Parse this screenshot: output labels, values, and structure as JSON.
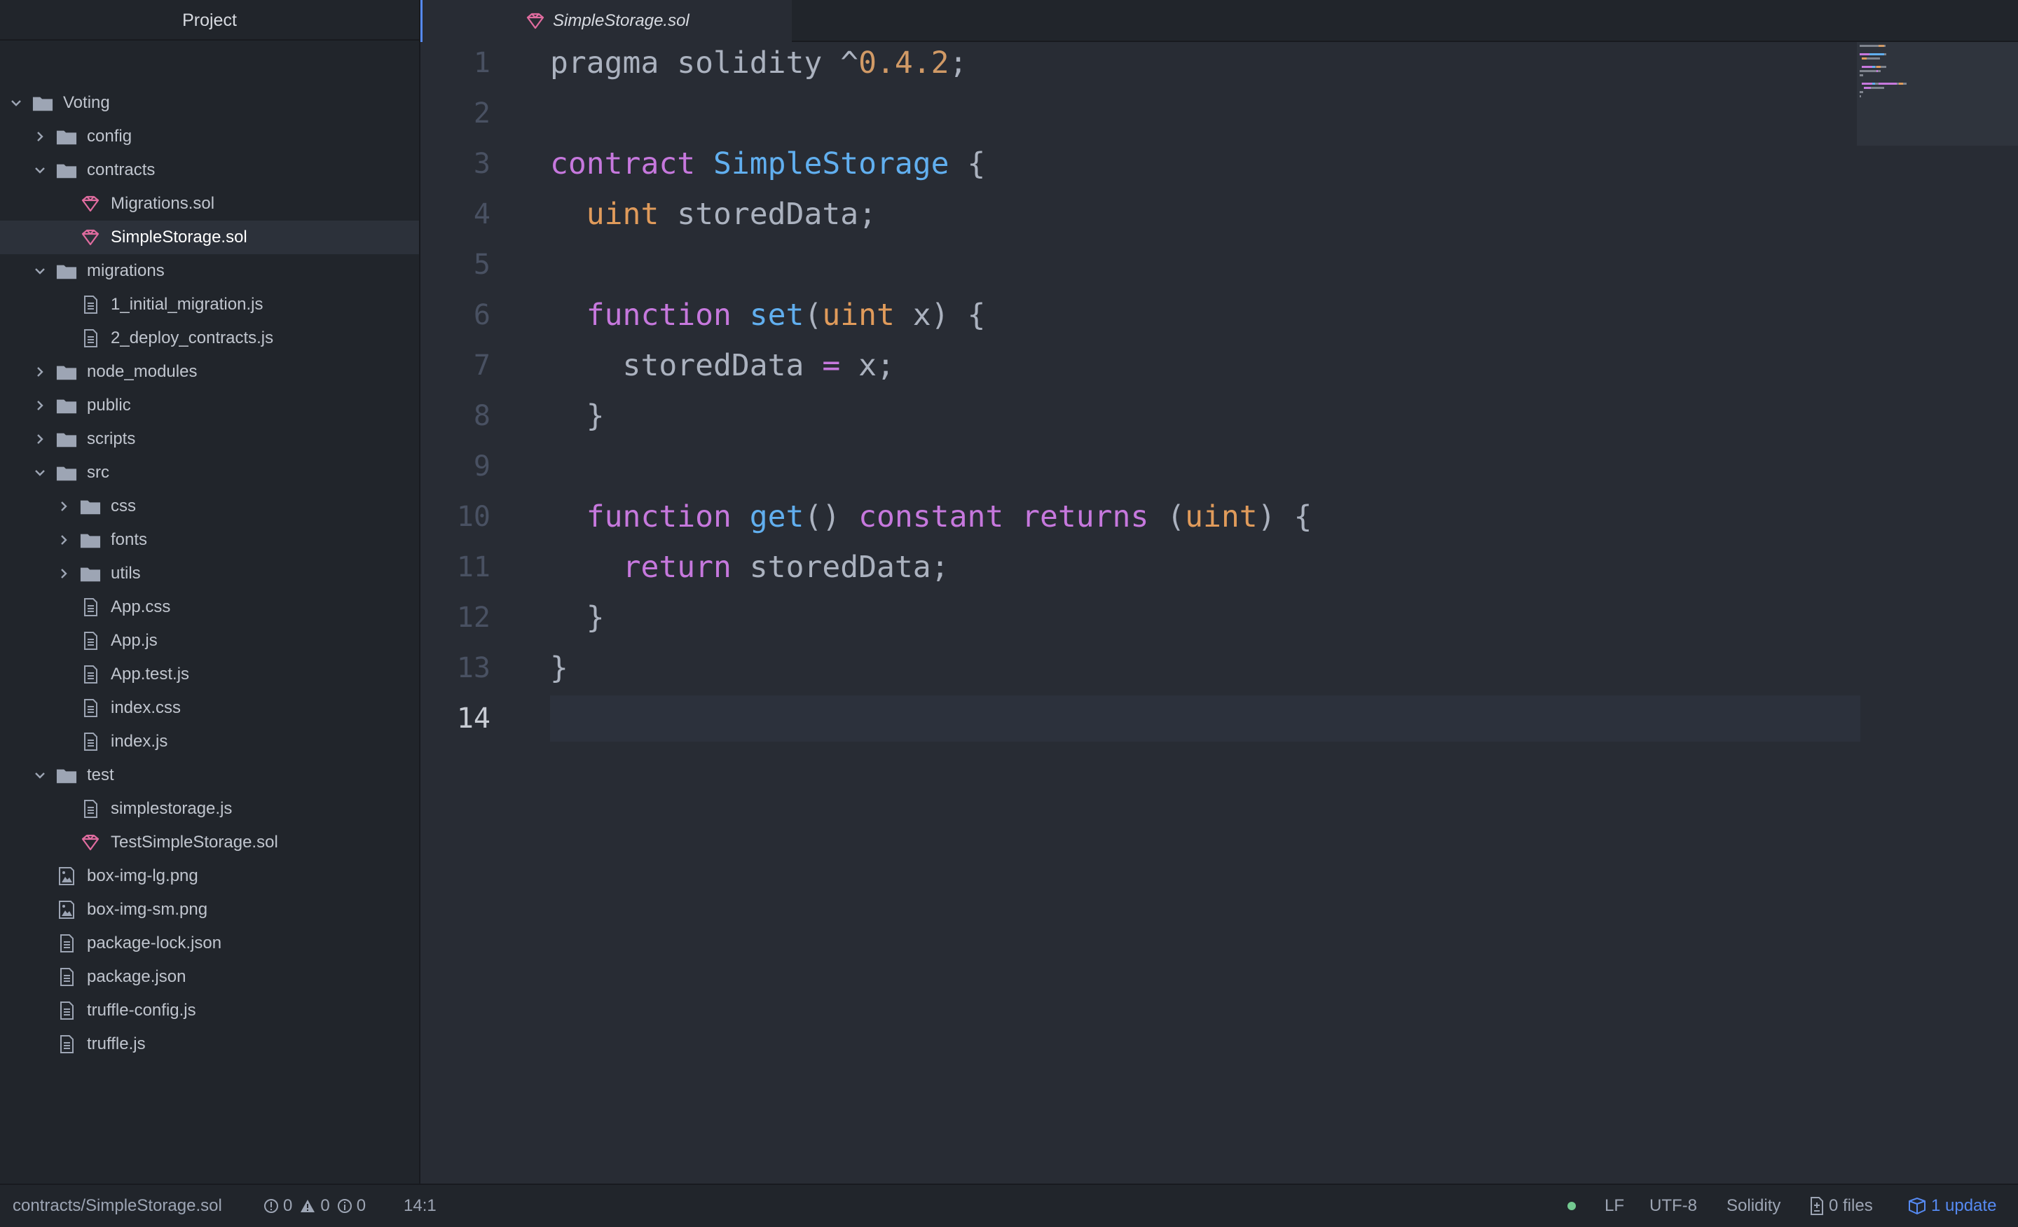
{
  "sidebar": {
    "title": "Project",
    "tree": [
      {
        "label": "Voting",
        "kind": "folder",
        "expanded": true,
        "depth": 0
      },
      {
        "label": "config",
        "kind": "folder",
        "expanded": false,
        "depth": 1
      },
      {
        "label": "contracts",
        "kind": "folder",
        "expanded": true,
        "depth": 1
      },
      {
        "label": "Migrations.sol",
        "kind": "sol",
        "depth": 2
      },
      {
        "label": "SimpleStorage.sol",
        "kind": "sol",
        "depth": 2,
        "selected": true
      },
      {
        "label": "migrations",
        "kind": "folder",
        "expanded": true,
        "depth": 1
      },
      {
        "label": "1_initial_migration.js",
        "kind": "file",
        "depth": 2
      },
      {
        "label": "2_deploy_contracts.js",
        "kind": "file",
        "depth": 2
      },
      {
        "label": "node_modules",
        "kind": "folder",
        "expanded": false,
        "depth": 1
      },
      {
        "label": "public",
        "kind": "folder",
        "expanded": false,
        "depth": 1
      },
      {
        "label": "scripts",
        "kind": "folder",
        "expanded": false,
        "depth": 1
      },
      {
        "label": "src",
        "kind": "folder",
        "expanded": true,
        "depth": 1
      },
      {
        "label": "css",
        "kind": "folder",
        "expanded": false,
        "depth": 2
      },
      {
        "label": "fonts",
        "kind": "folder",
        "expanded": false,
        "depth": 2
      },
      {
        "label": "utils",
        "kind": "folder",
        "expanded": false,
        "depth": 2
      },
      {
        "label": "App.css",
        "kind": "file",
        "depth": 2
      },
      {
        "label": "App.js",
        "kind": "file",
        "depth": 2
      },
      {
        "label": "App.test.js",
        "kind": "file",
        "depth": 2
      },
      {
        "label": "index.css",
        "kind": "file",
        "depth": 2
      },
      {
        "label": "index.js",
        "kind": "file",
        "depth": 2
      },
      {
        "label": "test",
        "kind": "folder",
        "expanded": true,
        "depth": 1
      },
      {
        "label": "simplestorage.js",
        "kind": "file",
        "depth": 2
      },
      {
        "label": "TestSimpleStorage.sol",
        "kind": "sol",
        "depth": 2
      },
      {
        "label": "box-img-lg.png",
        "kind": "image",
        "depth": 1
      },
      {
        "label": "box-img-sm.png",
        "kind": "image",
        "depth": 1
      },
      {
        "label": "package-lock.json",
        "kind": "file",
        "depth": 1
      },
      {
        "label": "package.json",
        "kind": "file",
        "depth": 1
      },
      {
        "label": "truffle-config.js",
        "kind": "file",
        "depth": 1
      },
      {
        "label": "truffle.js",
        "kind": "file",
        "depth": 1
      }
    ]
  },
  "tabs": [
    {
      "label": "SimpleStorage.sol",
      "icon": "solidity-icon",
      "active": true
    }
  ],
  "editor": {
    "cursor_line": 14,
    "lines": [
      [
        {
          "t": "pragma solidity ^",
          "c": "txt"
        },
        {
          "t": "0.4.2",
          "c": "num"
        },
        {
          "t": ";",
          "c": "txt"
        }
      ],
      [],
      [
        {
          "t": "contract ",
          "c": "kw"
        },
        {
          "t": "SimpleStorage",
          "c": "fn"
        },
        {
          "t": " {",
          "c": "txt"
        }
      ],
      [
        {
          "t": "  ",
          "c": "txt"
        },
        {
          "t": "uint",
          "c": "ty"
        },
        {
          "t": " storedData;",
          "c": "txt"
        }
      ],
      [],
      [
        {
          "t": "  ",
          "c": "txt"
        },
        {
          "t": "function ",
          "c": "kw"
        },
        {
          "t": "set",
          "c": "fn"
        },
        {
          "t": "(",
          "c": "txt"
        },
        {
          "t": "uint",
          "c": "ty"
        },
        {
          "t": " x) {",
          "c": "txt"
        }
      ],
      [
        {
          "t": "    storedData ",
          "c": "txt"
        },
        {
          "t": "=",
          "c": "kw"
        },
        {
          "t": " x;",
          "c": "txt"
        }
      ],
      [
        {
          "t": "  }",
          "c": "txt"
        }
      ],
      [],
      [
        {
          "t": "  ",
          "c": "txt"
        },
        {
          "t": "function ",
          "c": "kw"
        },
        {
          "t": "get",
          "c": "fn"
        },
        {
          "t": "() ",
          "c": "txt"
        },
        {
          "t": "constant returns",
          "c": "kw"
        },
        {
          "t": " (",
          "c": "txt"
        },
        {
          "t": "uint",
          "c": "ty"
        },
        {
          "t": ") {",
          "c": "txt"
        }
      ],
      [
        {
          "t": "    ",
          "c": "txt"
        },
        {
          "t": "return",
          "c": "kw"
        },
        {
          "t": " storedData;",
          "c": "txt"
        }
      ],
      [
        {
          "t": "  }",
          "c": "txt"
        }
      ],
      [
        {
          "t": "}",
          "c": "txt"
        }
      ],
      []
    ]
  },
  "statusbar": {
    "file_path": "contracts/SimpleStorage.sol",
    "errors": "0",
    "warnings": "0",
    "infos": "0",
    "cursor_position": "14:1",
    "line_ending": "LF",
    "encoding": "UTF-8",
    "grammar": "Solidity",
    "git_files": "0 files",
    "updates": "1 update",
    "colors": {
      "dot": "#73c990",
      "update": "#568af2"
    }
  },
  "colors": {
    "editor_bg": "#282c34",
    "sidebar_bg": "#21252b",
    "accent": "#568af2",
    "solidity_icon": "#e06c9f"
  }
}
